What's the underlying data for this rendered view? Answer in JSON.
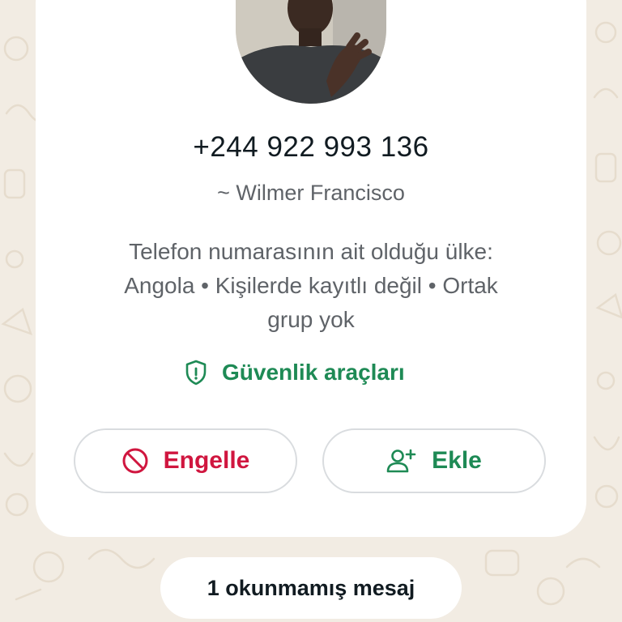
{
  "contact": {
    "phone_number": "+244 922 993 136",
    "push_name": "~ Wilmer Francisco",
    "info_lines": [
      "Telefon numarasının ait olduğu ülke:",
      "Angola • Kişilerde kayıtlı değil • Ortak",
      "grup yok"
    ],
    "avatar_icon": "profile-photo"
  },
  "safety_tools": {
    "label": "Güvenlik araçları",
    "icon": "shield-icon",
    "color": "#1e8a55"
  },
  "actions": {
    "block": {
      "label": "Engelle",
      "icon": "block-icon",
      "color": "#d0163f"
    },
    "add": {
      "label": "Ekle",
      "icon": "add-person-icon",
      "color": "#1e8a55"
    }
  },
  "unread_banner": {
    "label": "1 okunmamış mesaj"
  },
  "colors": {
    "wallpaper": "#f2ece3",
    "card": "#ffffff",
    "accent_green": "#1e8a55",
    "danger_red": "#d0163f"
  }
}
